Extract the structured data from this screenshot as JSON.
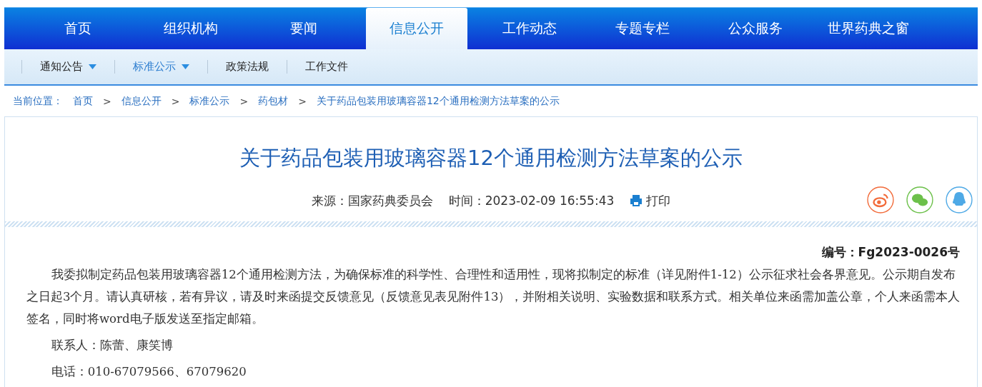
{
  "nav": {
    "tabs": [
      {
        "label": "首页",
        "selected": false
      },
      {
        "label": "组织机构",
        "selected": false
      },
      {
        "label": "要闻",
        "selected": false
      },
      {
        "label": "信息公开",
        "selected": true
      },
      {
        "label": "工作动态",
        "selected": false
      },
      {
        "label": "专题专栏",
        "selected": false
      },
      {
        "label": "公众服务",
        "selected": false
      },
      {
        "label": "世界药典之窗",
        "selected": false
      }
    ]
  },
  "subnav": {
    "items": [
      {
        "label": "通知公告",
        "dropdown": true,
        "selected": false
      },
      {
        "label": "标准公示",
        "dropdown": true,
        "selected": true
      },
      {
        "label": "政策法规",
        "dropdown": false,
        "selected": false
      },
      {
        "label": "工作文件",
        "dropdown": false,
        "selected": false
      }
    ]
  },
  "breadcrumb": {
    "label": "当前位置：",
    "separator": ">",
    "items": [
      "首页",
      "信息公开",
      "标准公示",
      "药包材",
      "关于药品包装用玻璃容器12个通用检测方法草案的公示"
    ]
  },
  "article": {
    "title": "关于药品包装用玻璃容器12个通用检测方法草案的公示",
    "source": "来源：国家药典委员会",
    "time": "时间：2023-02-09 16:55:43",
    "print": "打印",
    "share": [
      {
        "kind": "weibo",
        "color": "#f26b3a"
      },
      {
        "kind": "wechat",
        "color": "#6cc04a"
      },
      {
        "kind": "qq",
        "color": "#4ea9e6"
      }
    ],
    "number": "编号：Fg2023-0026号",
    "paragraphs": [
      "我委拟制定药品包装用玻璃容器12个通用检测方法，为确保标准的科学性、合理性和适用性，现将拟制定的标准（详见附件1-12）公示征求社会各界意见。公示期自发布之日起3个月。请认真研核，若有异议，请及时来函提交反馈意见（反馈意见表见附件13），并附相关说明、实验数据和联系方式。相关单位来函需加盖公章，个人来函需本人签名，同时将word电子版发送至指定邮箱。",
      "联系人：陈蕾、康笑博",
      "电话：010-67079566、67079620"
    ]
  }
}
